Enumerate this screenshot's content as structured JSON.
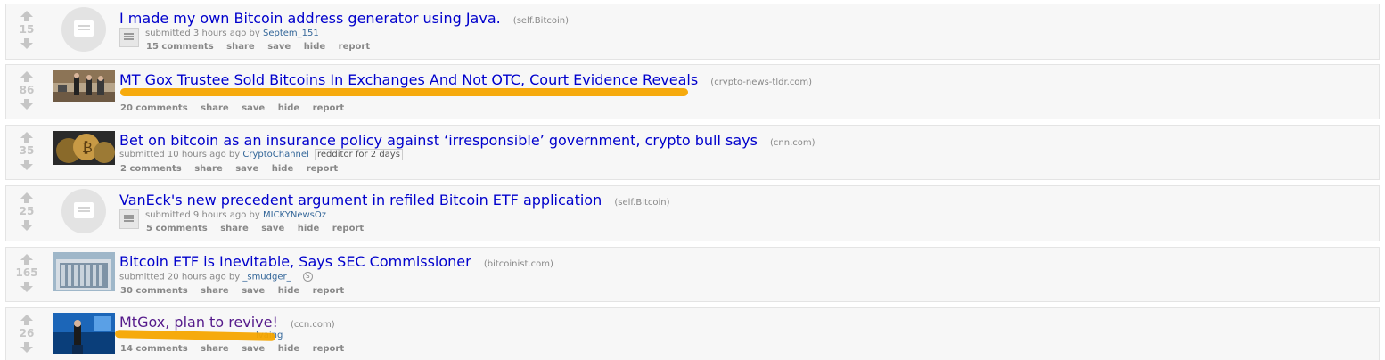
{
  "posts": [
    {
      "score": "15",
      "title": "I made my own Bitcoin address generator using Java.",
      "domain": "(self.Bitcoin)",
      "submitted": "submitted 3 hours ago by",
      "author": "Septem_151",
      "comments": "15 comments",
      "thumbnail": "self-text-icon"
    },
    {
      "score": "86",
      "title": "MT Gox Trustee Sold Bitcoins In Exchanges And Not OTC, Court Evidence Reveals",
      "domain": "(crypto-news-tldr.com)",
      "comments": "20 comments",
      "thumbnail": "court-photo"
    },
    {
      "score": "35",
      "title": "Bet on bitcoin as an insurance policy against ‘irresponsible’ government, crypto bull says",
      "domain": "(cnn.com)",
      "submitted": "submitted 10 hours ago by",
      "author": "CryptoChannel",
      "badge": "redditor for 2 days",
      "comments": "2 comments",
      "thumbnail": "bitcoin-coins-photo"
    },
    {
      "score": "25",
      "title": "VanEck's new precedent argument in refiled Bitcoin ETF application",
      "domain": "(self.Bitcoin)",
      "submitted": "submitted 9 hours ago by",
      "author": "MICKYNewsOz",
      "comments": "5 comments",
      "thumbnail": "self-text-icon"
    },
    {
      "score": "165",
      "title": "Bitcoin ETF is Inevitable, Says SEC Commissioner",
      "domain": "(bitcoinist.com)",
      "submitted": "submitted 20 hours ago by",
      "author": "_smudger_",
      "comments": "30 comments",
      "thumbnail": "sec-building-photo"
    },
    {
      "score": "26",
      "title": "MtGox, plan to revive!",
      "domain": "(ccn.com)",
      "author_partial": "lvaing",
      "comments": "14 comments",
      "thumbnail": "speaker-stage-photo"
    }
  ],
  "actions": {
    "share": "share",
    "save": "save",
    "hide": "hide",
    "report": "report"
  },
  "colors": {
    "link": "#0000cc",
    "visited": "#551a8b",
    "highlight": "#f5a500",
    "meta": "#888888"
  }
}
